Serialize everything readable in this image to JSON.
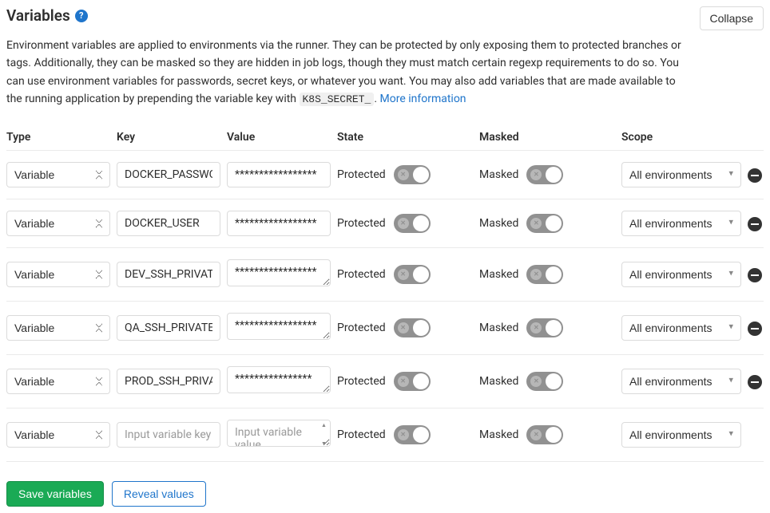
{
  "header": {
    "title": "Variables",
    "collapse_label": "Collapse"
  },
  "description": {
    "text_before_code": "Environment variables are applied to environments via the runner. They can be protected by only exposing them to protected branches or tags. Additionally, they can be masked so they are hidden in job logs, though they must match certain regexp requirements to do so. You can use environment variables for passwords, secret keys, or whatever you want. You may also add variables that are made available to the running application by prepending the variable key with ",
    "code": "K8S_SECRET_",
    "text_after_code": ". ",
    "link_text": "More information"
  },
  "columns": {
    "type": "Type",
    "key": "Key",
    "value": "Value",
    "state": "State",
    "masked": "Masked",
    "scope": "Scope"
  },
  "labels": {
    "protected": "Protected",
    "masked": "Masked",
    "type_option": "Variable",
    "scope_option": "All environments",
    "key_placeholder": "Input variable key",
    "value_placeholder": "Input variable value"
  },
  "rows": [
    {
      "key": "DOCKER_PASSWORD",
      "value": "*****************",
      "removable": true,
      "multiline": false
    },
    {
      "key": "DOCKER_USER",
      "value": "*****************",
      "removable": true,
      "multiline": false
    },
    {
      "key": "DEV_SSH_PRIVATE_KEY",
      "value": "*****************",
      "removable": true,
      "multiline": true
    },
    {
      "key": "QA_SSH_PRIVATE_KEY",
      "value": "*****************",
      "removable": true,
      "multiline": true
    },
    {
      "key": "PROD_SSH_PRIVATE_KEY",
      "value": "****************",
      "removable": true,
      "multiline": true
    },
    {
      "key": "",
      "value": "",
      "removable": false,
      "multiline": true
    }
  ],
  "actions": {
    "save_label": "Save variables",
    "reveal_label": "Reveal values"
  }
}
